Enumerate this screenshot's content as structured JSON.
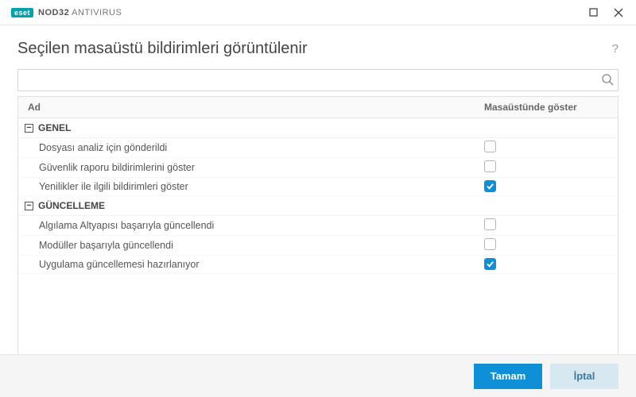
{
  "titlebar": {
    "logo": "eset",
    "product_bold": "NOD32",
    "product_rest": "ANTIVIRUS"
  },
  "page_title": "Seçilen masaüstü bildirimleri görüntülenir",
  "columns": {
    "name": "Ad",
    "show": "Masaüstünde göster"
  },
  "groups": [
    {
      "label": "GENEL",
      "items": [
        {
          "label": "Dosyası analiz için gönderildi",
          "checked": false
        },
        {
          "label": "Güvenlik raporu bildirimlerini göster",
          "checked": false
        },
        {
          "label": "Yenilikler ile ilgili bildirimleri göster",
          "checked": true
        }
      ]
    },
    {
      "label": "GÜNCELLEME",
      "items": [
        {
          "label": "Algılama Altyapısı başarıyla güncellendi",
          "checked": false
        },
        {
          "label": "Modüller başarıyla güncellendi",
          "checked": false
        },
        {
          "label": "Uygulama güncellemesi hazırlanıyor",
          "checked": true
        }
      ]
    }
  ],
  "buttons": {
    "ok": "Tamam",
    "cancel": "İptal"
  }
}
